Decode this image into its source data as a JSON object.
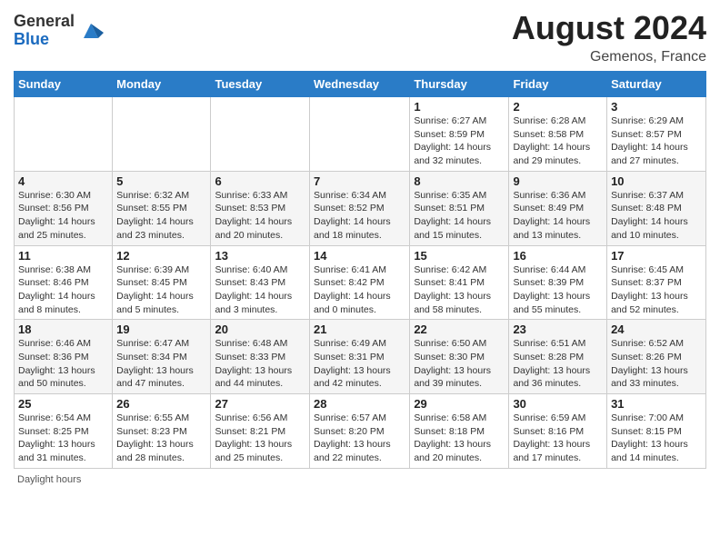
{
  "header": {
    "logo_general": "General",
    "logo_blue": "Blue",
    "title": "August 2024",
    "location": "Gemenos, France"
  },
  "days_of_week": [
    "Sunday",
    "Monday",
    "Tuesday",
    "Wednesday",
    "Thursday",
    "Friday",
    "Saturday"
  ],
  "weeks": [
    [
      {
        "day": "",
        "info": ""
      },
      {
        "day": "",
        "info": ""
      },
      {
        "day": "",
        "info": ""
      },
      {
        "day": "",
        "info": ""
      },
      {
        "day": "1",
        "info": "Sunrise: 6:27 AM\nSunset: 8:59 PM\nDaylight: 14 hours and 32 minutes."
      },
      {
        "day": "2",
        "info": "Sunrise: 6:28 AM\nSunset: 8:58 PM\nDaylight: 14 hours and 29 minutes."
      },
      {
        "day": "3",
        "info": "Sunrise: 6:29 AM\nSunset: 8:57 PM\nDaylight: 14 hours and 27 minutes."
      }
    ],
    [
      {
        "day": "4",
        "info": "Sunrise: 6:30 AM\nSunset: 8:56 PM\nDaylight: 14 hours and 25 minutes."
      },
      {
        "day": "5",
        "info": "Sunrise: 6:32 AM\nSunset: 8:55 PM\nDaylight: 14 hours and 23 minutes."
      },
      {
        "day": "6",
        "info": "Sunrise: 6:33 AM\nSunset: 8:53 PM\nDaylight: 14 hours and 20 minutes."
      },
      {
        "day": "7",
        "info": "Sunrise: 6:34 AM\nSunset: 8:52 PM\nDaylight: 14 hours and 18 minutes."
      },
      {
        "day": "8",
        "info": "Sunrise: 6:35 AM\nSunset: 8:51 PM\nDaylight: 14 hours and 15 minutes."
      },
      {
        "day": "9",
        "info": "Sunrise: 6:36 AM\nSunset: 8:49 PM\nDaylight: 14 hours and 13 minutes."
      },
      {
        "day": "10",
        "info": "Sunrise: 6:37 AM\nSunset: 8:48 PM\nDaylight: 14 hours and 10 minutes."
      }
    ],
    [
      {
        "day": "11",
        "info": "Sunrise: 6:38 AM\nSunset: 8:46 PM\nDaylight: 14 hours and 8 minutes."
      },
      {
        "day": "12",
        "info": "Sunrise: 6:39 AM\nSunset: 8:45 PM\nDaylight: 14 hours and 5 minutes."
      },
      {
        "day": "13",
        "info": "Sunrise: 6:40 AM\nSunset: 8:43 PM\nDaylight: 14 hours and 3 minutes."
      },
      {
        "day": "14",
        "info": "Sunrise: 6:41 AM\nSunset: 8:42 PM\nDaylight: 14 hours and 0 minutes."
      },
      {
        "day": "15",
        "info": "Sunrise: 6:42 AM\nSunset: 8:41 PM\nDaylight: 13 hours and 58 minutes."
      },
      {
        "day": "16",
        "info": "Sunrise: 6:44 AM\nSunset: 8:39 PM\nDaylight: 13 hours and 55 minutes."
      },
      {
        "day": "17",
        "info": "Sunrise: 6:45 AM\nSunset: 8:37 PM\nDaylight: 13 hours and 52 minutes."
      }
    ],
    [
      {
        "day": "18",
        "info": "Sunrise: 6:46 AM\nSunset: 8:36 PM\nDaylight: 13 hours and 50 minutes."
      },
      {
        "day": "19",
        "info": "Sunrise: 6:47 AM\nSunset: 8:34 PM\nDaylight: 13 hours and 47 minutes."
      },
      {
        "day": "20",
        "info": "Sunrise: 6:48 AM\nSunset: 8:33 PM\nDaylight: 13 hours and 44 minutes."
      },
      {
        "day": "21",
        "info": "Sunrise: 6:49 AM\nSunset: 8:31 PM\nDaylight: 13 hours and 42 minutes."
      },
      {
        "day": "22",
        "info": "Sunrise: 6:50 AM\nSunset: 8:30 PM\nDaylight: 13 hours and 39 minutes."
      },
      {
        "day": "23",
        "info": "Sunrise: 6:51 AM\nSunset: 8:28 PM\nDaylight: 13 hours and 36 minutes."
      },
      {
        "day": "24",
        "info": "Sunrise: 6:52 AM\nSunset: 8:26 PM\nDaylight: 13 hours and 33 minutes."
      }
    ],
    [
      {
        "day": "25",
        "info": "Sunrise: 6:54 AM\nSunset: 8:25 PM\nDaylight: 13 hours and 31 minutes."
      },
      {
        "day": "26",
        "info": "Sunrise: 6:55 AM\nSunset: 8:23 PM\nDaylight: 13 hours and 28 minutes."
      },
      {
        "day": "27",
        "info": "Sunrise: 6:56 AM\nSunset: 8:21 PM\nDaylight: 13 hours and 25 minutes."
      },
      {
        "day": "28",
        "info": "Sunrise: 6:57 AM\nSunset: 8:20 PM\nDaylight: 13 hours and 22 minutes."
      },
      {
        "day": "29",
        "info": "Sunrise: 6:58 AM\nSunset: 8:18 PM\nDaylight: 13 hours and 20 minutes."
      },
      {
        "day": "30",
        "info": "Sunrise: 6:59 AM\nSunset: 8:16 PM\nDaylight: 13 hours and 17 minutes."
      },
      {
        "day": "31",
        "info": "Sunrise: 7:00 AM\nSunset: 8:15 PM\nDaylight: 13 hours and 14 minutes."
      }
    ]
  ],
  "footer": {
    "label": "Daylight hours"
  }
}
